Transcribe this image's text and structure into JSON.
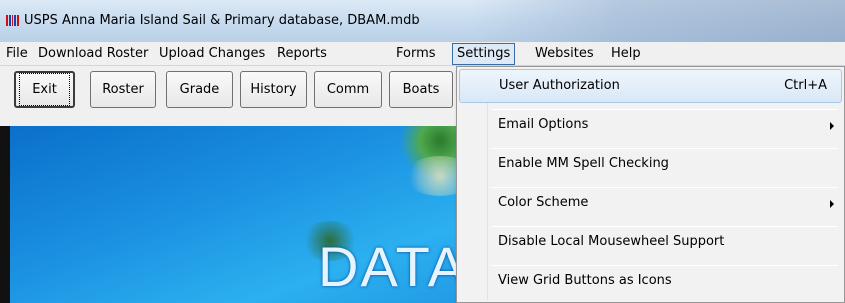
{
  "window": {
    "title": "USPS Anna Maria Island Sail & Primary database, DBAM.mdb",
    "icon": "app-barcode-icon",
    "icon_colors": [
      "#d01010",
      "#1a3fb0",
      "#d01010",
      "#1a3fb0",
      "#d01010"
    ]
  },
  "menubar": {
    "items": [
      {
        "label": "File"
      },
      {
        "label": "Download Roster"
      },
      {
        "label": "Upload Changes"
      },
      {
        "label": "Reports"
      },
      {
        "label": "Forms"
      },
      {
        "label": "Settings",
        "open": true
      },
      {
        "label": "Websites"
      },
      {
        "label": "Help"
      }
    ]
  },
  "toolbar": {
    "buttons": [
      {
        "label": "Exit",
        "focused": true
      },
      {
        "label": "Roster"
      },
      {
        "label": "Grade"
      },
      {
        "label": "History"
      },
      {
        "label": "Comm"
      },
      {
        "label": "Boats"
      }
    ]
  },
  "background": {
    "banner_text": "DATA",
    "colors": {
      "sky": "#1a8fe0",
      "accent": "#2cb0f0"
    }
  },
  "settings_menu": {
    "items": [
      {
        "label": "User Authorization",
        "shortcut": "Ctrl+A",
        "highlighted": true
      },
      {
        "label": "Email Options",
        "submenu": true
      },
      {
        "label": "Enable MM Spell Checking"
      },
      {
        "label": "Color Scheme",
        "submenu": true
      },
      {
        "label": "Disable Local Mousewheel Support"
      },
      {
        "label": "View Grid Buttons as Icons"
      }
    ]
  }
}
